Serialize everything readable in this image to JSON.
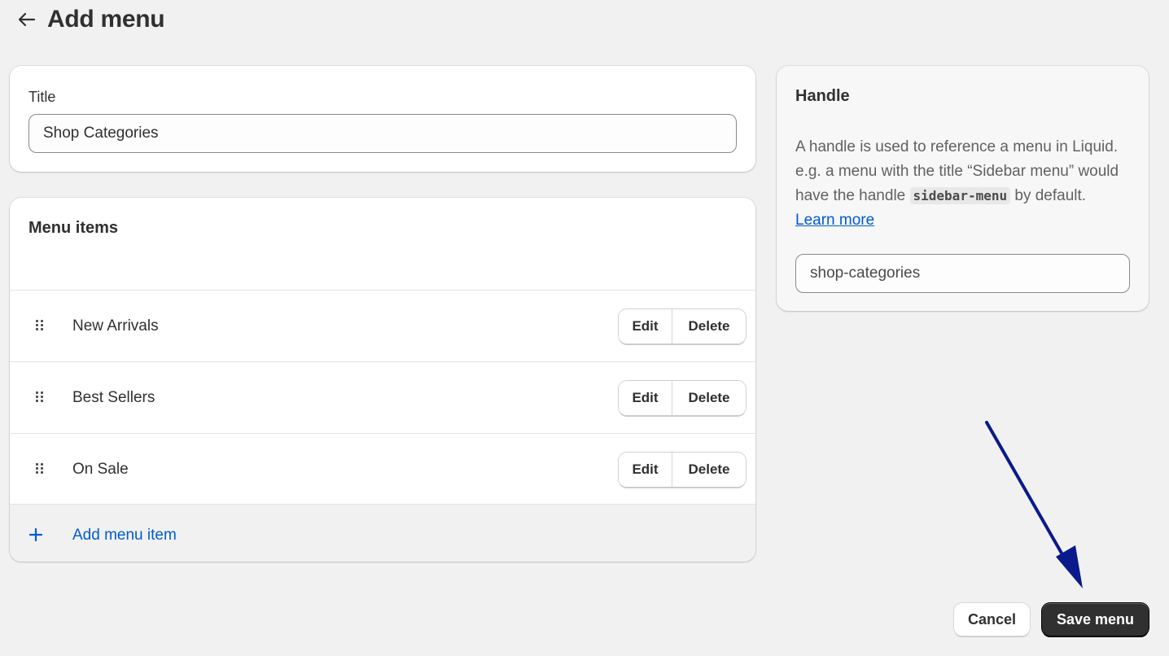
{
  "header": {
    "title": "Add menu",
    "back_icon": "arrow-left-icon"
  },
  "title_section": {
    "label": "Title",
    "value": "Shop Categories"
  },
  "menu_items_section": {
    "heading": "Menu items",
    "items": [
      {
        "label": "New Arrivals",
        "edit_label": "Edit",
        "delete_label": "Delete"
      },
      {
        "label": "Best Sellers",
        "edit_label": "Edit",
        "delete_label": "Delete"
      },
      {
        "label": "On Sale",
        "edit_label": "Edit",
        "delete_label": "Delete"
      }
    ],
    "add_label": "Add menu item"
  },
  "handle_section": {
    "heading": "Handle",
    "desc_before": "A handle is used to reference a menu in Liquid. e.g. a menu with the title “Sidebar menu” would have the handle ",
    "code": "sidebar-menu",
    "desc_after": " by default. ",
    "learn_more": "Learn more",
    "value": "shop-categories"
  },
  "footer": {
    "cancel_label": "Cancel",
    "save_label": "Save menu"
  },
  "colors": {
    "background": "#f1f1f1",
    "primary_button": "#303030",
    "link": "#005bd3",
    "annotation_arrow": "#0a1a8c"
  }
}
